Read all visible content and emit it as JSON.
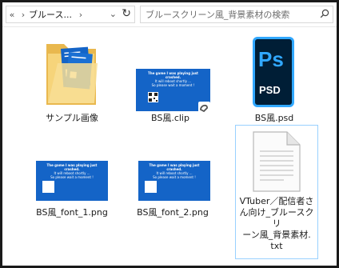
{
  "addressbar": {
    "breadcrumb": "ブルース...",
    "back_glyph": "«",
    "chevron_glyph": "›",
    "dropdown_glyph": "⌄",
    "refresh_glyph": "↻"
  },
  "search": {
    "placeholder": "ブルースクリーン風_背景素材の検索",
    "icon": "search-icon"
  },
  "files": [
    {
      "name": "サンプル画像",
      "type": "folder"
    },
    {
      "name": "BS風.clip",
      "type": "clip"
    },
    {
      "name": "BS風.psd",
      "type": "psd",
      "icon_text": "Ps",
      "badge": "PSD"
    },
    {
      "name": "BS風_font_1.png",
      "type": "png"
    },
    {
      "name": "BS風_font_2.png",
      "type": "png"
    },
    {
      "name": "VTuber／配信者さん向け_ブルースクリーン風_背景素材.txt",
      "type": "txt",
      "selected": true,
      "label_lines": [
        "VTuber／配信者さ",
        "ん向け_ブルースクリ",
        "ーン風_背景素材.",
        "txt"
      ]
    }
  ],
  "thumbnail_text": {
    "line1": "The game I was playing just crashed.",
    "line2": "It will reboot shortly ...",
    "line3": "So please wait a moment !"
  },
  "colors": {
    "bsod_blue": "#1464c7",
    "ps_dark": "#001e36",
    "ps_blue": "#31a8ff",
    "selection_border": "#99d1ff",
    "folder": "#f6d47a"
  }
}
